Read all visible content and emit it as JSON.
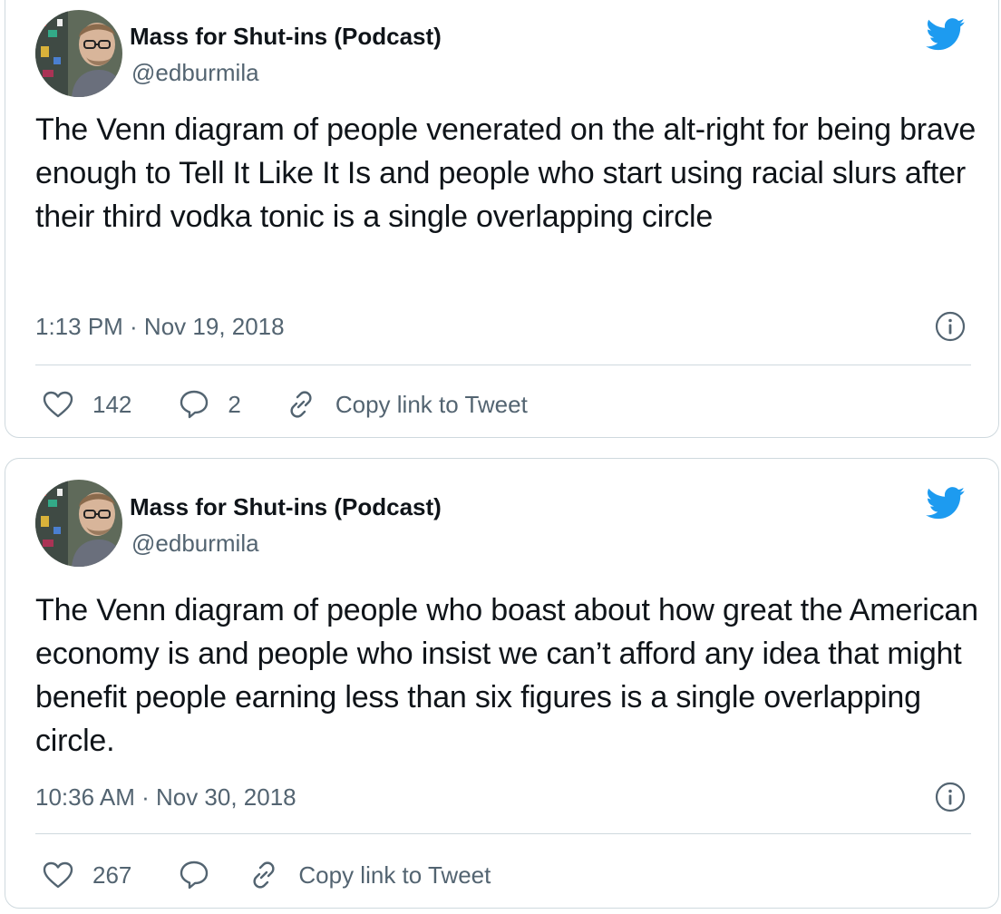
{
  "colors": {
    "brand_blue": "#1d9bf0",
    "secondary_text": "#536471",
    "border": "#cfd9de"
  },
  "icons": {
    "logo": "twitter-bird-icon",
    "info": "info-circle-icon",
    "like": "heart-outline-icon",
    "reply": "speech-bubble-icon",
    "copy_link": "chain-link-icon"
  },
  "tweets": [
    {
      "author": {
        "name": "Mass for Shut-ins (Podcast)",
        "handle": "@edburmila"
      },
      "text": "The Venn diagram of people venerated on the alt-right for being brave enough to Tell It Like It Is and people who start using racial slurs after their third vodka tonic is a single overlapping circle",
      "timestamp": "1:13 PM · Nov 19, 2018",
      "likes": "142",
      "replies": "2",
      "copy_link_label": "Copy link to Tweet"
    },
    {
      "author": {
        "name": "Mass for Shut-ins (Podcast)",
        "handle": "@edburmila"
      },
      "text": "The Venn diagram of people who boast about how great the American economy is and people who insist we can’t afford any idea that might benefit people earning less than six figures is a single overlapping circle.",
      "timestamp": "10:36 AM · Nov 30, 2018",
      "likes": "267",
      "replies": "",
      "copy_link_label": "Copy link to Tweet"
    }
  ]
}
